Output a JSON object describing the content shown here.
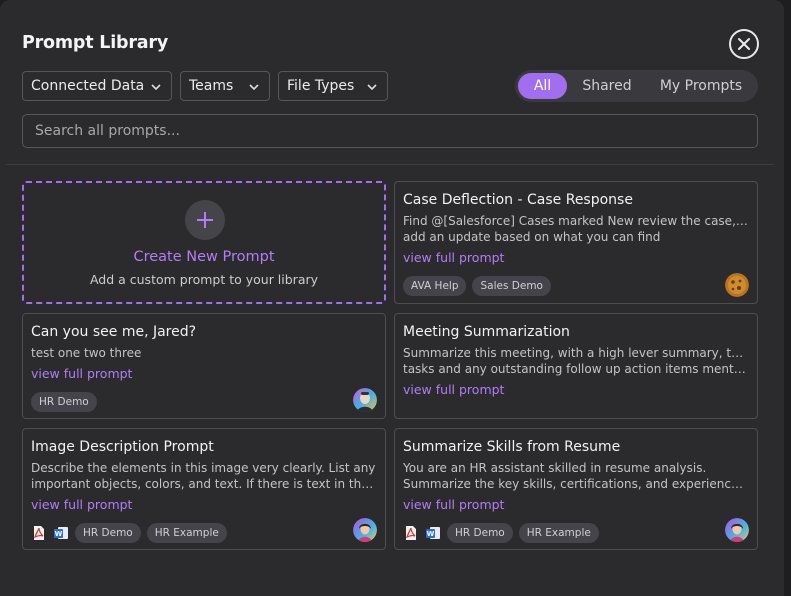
{
  "header": {
    "title": "Prompt Library",
    "close_icon": "close-icon"
  },
  "filters": [
    {
      "label": "Connected Data",
      "icon": "chevron-down-icon"
    },
    {
      "label": "Teams",
      "icon": "chevron-down-icon"
    },
    {
      "label": "File Types",
      "icon": "chevron-down-icon"
    }
  ],
  "segments": {
    "items": [
      "All",
      "Shared",
      "My Prompts"
    ],
    "active": "All"
  },
  "search": {
    "placeholder": "Search all prompts...",
    "value": ""
  },
  "create": {
    "icon": "plus-icon",
    "title": "Create New Prompt",
    "subtitle": "Add a custom prompt to your library"
  },
  "cards": [
    {
      "title": "Case Deflection - Case Response",
      "desc": [
        "Find @[Salesforce] Cases marked New review the case, and",
        "add an update based on what you can find"
      ],
      "link": "view full prompt",
      "file_icons": [],
      "tags": [
        "AVA Help",
        "Sales Demo"
      ],
      "avatar": "cookie-avatar"
    },
    {
      "title": "Can you see me, Jared?",
      "desc": [
        "test one two three"
      ],
      "link": "view full prompt",
      "file_icons": [],
      "tags": [
        "HR Demo"
      ],
      "avatar": "user-avatar"
    },
    {
      "title": "Meeting Summarization",
      "desc": [
        "Summarize this meeting, with a high lever summary, then",
        "tasks and any outstanding follow up action items mentione..."
      ],
      "link": "view full prompt",
      "file_icons": [],
      "tags": [],
      "avatar": ""
    },
    {
      "title": "Image Description Prompt",
      "desc": [
        "Describe the elements in this image very clearly. List any",
        "important objects, colors, and text. If there is text in the..."
      ],
      "link": "view full prompt",
      "file_icons": [
        "pdf-icon",
        "word-icon"
      ],
      "tags": [
        "HR Demo",
        "HR Example"
      ],
      "avatar": "user-avatar"
    },
    {
      "title": "Summarize Skills from Resume",
      "desc": [
        "You are an HR assistant skilled in resume analysis.",
        "Summarize the key skills, certifications, and experiences fro..."
      ],
      "link": "view full prompt",
      "file_icons": [
        "pdf-icon",
        "word-icon"
      ],
      "tags": [
        "HR Demo",
        "HR Example"
      ],
      "avatar": "user-avatar"
    }
  ],
  "colors": {
    "accent": "#a26ef0",
    "link": "#b27df5",
    "background": "#2b2b2e",
    "pdf": "#d9342b",
    "word": "#2b6fd6"
  }
}
